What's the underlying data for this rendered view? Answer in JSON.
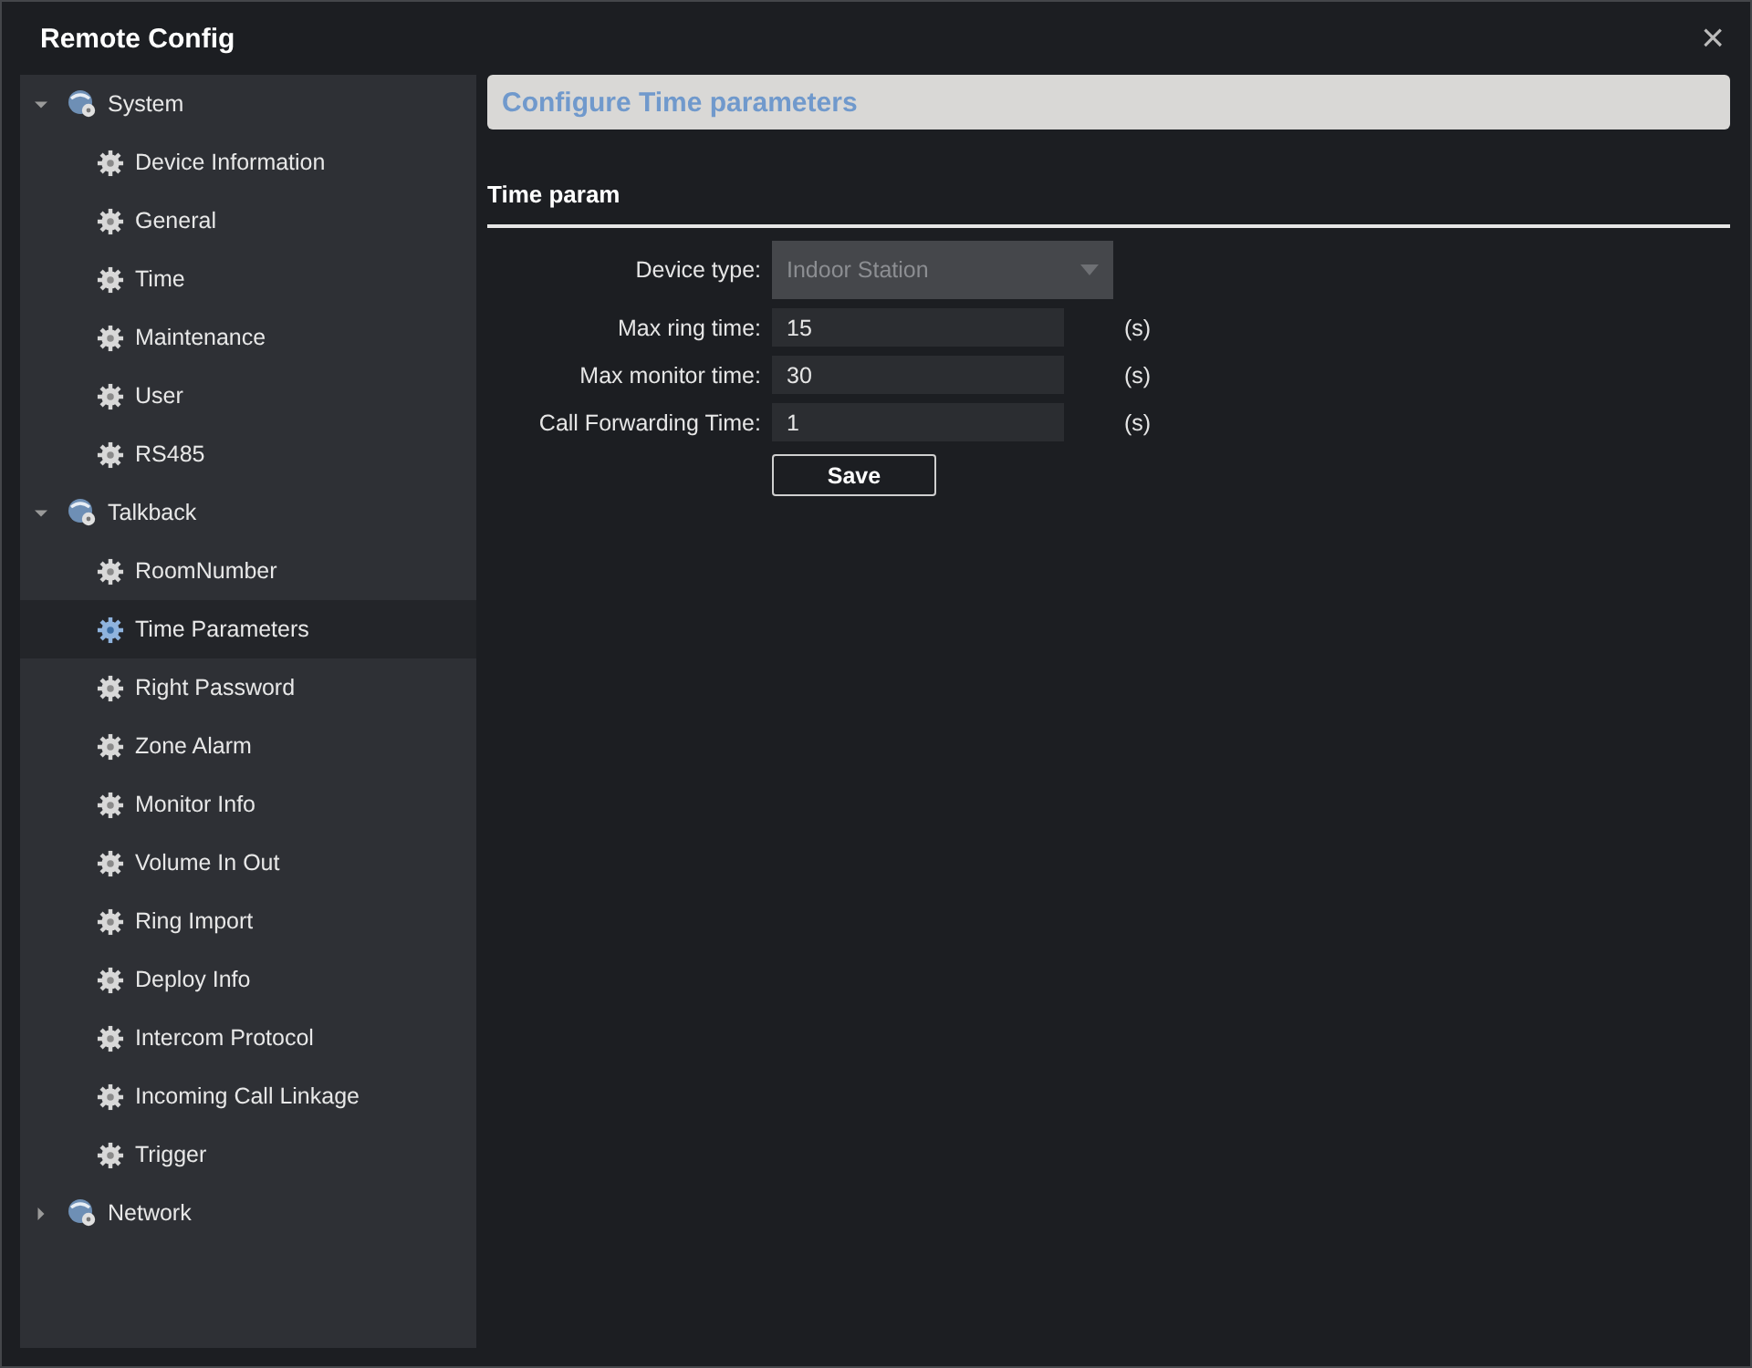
{
  "window": {
    "title": "Remote Config",
    "close": "×"
  },
  "sidebar": {
    "items": [
      {
        "label": "System",
        "expanded": true,
        "children": [
          {
            "label": "Device Information",
            "selected": false
          },
          {
            "label": "General",
            "selected": false
          },
          {
            "label": "Time",
            "selected": false
          },
          {
            "label": "Maintenance",
            "selected": false
          },
          {
            "label": "User",
            "selected": false
          },
          {
            "label": "RS485",
            "selected": false
          }
        ]
      },
      {
        "label": "Talkback",
        "expanded": true,
        "children": [
          {
            "label": "RoomNumber",
            "selected": false
          },
          {
            "label": "Time Parameters",
            "selected": true
          },
          {
            "label": "Right Password",
            "selected": false
          },
          {
            "label": "Zone Alarm",
            "selected": false
          },
          {
            "label": "Monitor Info",
            "selected": false
          },
          {
            "label": "Volume In Out",
            "selected": false
          },
          {
            "label": "Ring Import",
            "selected": false
          },
          {
            "label": "Deploy Info",
            "selected": false
          },
          {
            "label": "Intercom Protocol",
            "selected": false
          },
          {
            "label": "Incoming Call Linkage",
            "selected": false
          },
          {
            "label": "Trigger",
            "selected": false
          }
        ]
      },
      {
        "label": "Network",
        "expanded": false
      }
    ]
  },
  "content": {
    "header": "Configure Time parameters",
    "section": "Time param",
    "fields": [
      {
        "kind": "select",
        "label": "Device type:",
        "value": "Indoor Station",
        "disabled": true
      },
      {
        "kind": "input",
        "label": "Max ring time:",
        "value": "15",
        "unit": "(s)"
      },
      {
        "kind": "input",
        "label": "Max monitor time:",
        "value": "30",
        "unit": "(s)"
      },
      {
        "kind": "input",
        "label": "Call Forwarding Time:",
        "value": "1",
        "unit": "(s)"
      }
    ],
    "save_button": "Save"
  }
}
